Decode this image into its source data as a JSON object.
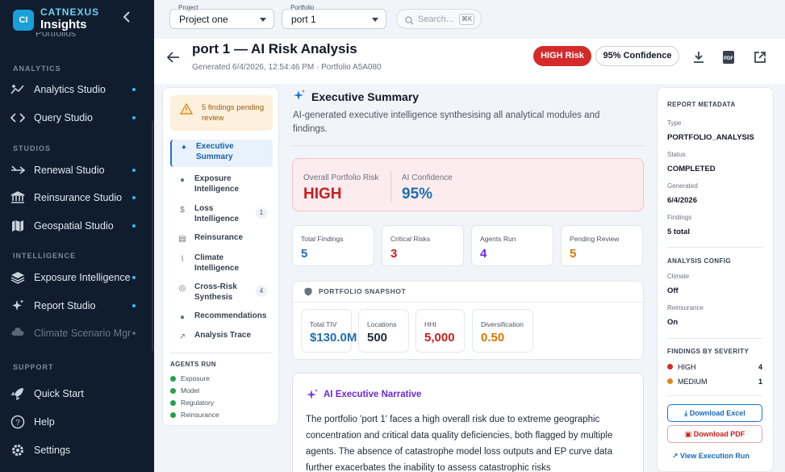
{
  "sidebar": {
    "brand_line1": "CATNEXUS",
    "brand_line2": "Insights",
    "logo_text": "CI",
    "ghost_item": "Portfolios",
    "sections": {
      "analytics": "ANALYTICS",
      "studios": "STUDIOS",
      "intelligence": "INTELLIGENCE",
      "support": "SUPPORT"
    },
    "items": [
      {
        "label": "Analytics Studio",
        "icon": "sparkle-chart-icon"
      },
      {
        "label": "Query Studio",
        "icon": "code-icon"
      },
      {
        "label": "Renewal Studio",
        "icon": "merge-arrow-icon"
      },
      {
        "label": "Reinsurance Studio",
        "icon": "bank-icon"
      },
      {
        "label": "Geospatial Studio",
        "icon": "map-icon"
      },
      {
        "label": "Exposure Intelligence",
        "icon": "layers-icon"
      },
      {
        "label": "Report Studio",
        "icon": "sparkles-icon"
      },
      {
        "label": "Climate Scenario Mgr",
        "icon": "cloud-icon"
      },
      {
        "label": "Quick Start",
        "icon": "rocket-icon"
      },
      {
        "label": "Help",
        "icon": "help-icon"
      },
      {
        "label": "Settings",
        "icon": "gear-icon"
      }
    ]
  },
  "topbar": {
    "project_caption": "Project",
    "project_value": "Project one",
    "portfolio_caption": "Portfolio",
    "portfolio_value": "port 1",
    "search_placeholder": "Search...",
    "search_shortcut": "⌘K"
  },
  "header": {
    "title": "port 1 — AI Risk Analysis",
    "subtitle": "Generated 6/4/2026, 12:54:46 PM · Portfolio A5A080",
    "risk_badge": "HIGH Risk",
    "confidence_badge": "95% Confidence"
  },
  "leftnav": {
    "pending": "5 findings pending review",
    "items": [
      {
        "label": "Executive Summary",
        "count": ""
      },
      {
        "label": "Exposure Intelligence",
        "count": ""
      },
      {
        "label": "Loss Intelligence",
        "count": "1"
      },
      {
        "label": "Reinsurance",
        "count": ""
      },
      {
        "label": "Climate Intelligence",
        "count": ""
      },
      {
        "label": "Cross-Risk Synthesis",
        "count": "4"
      },
      {
        "label": "Recommendations",
        "count": ""
      },
      {
        "label": "Analysis Trace",
        "count": ""
      }
    ],
    "agents_heading": "AGENTS RUN",
    "agents": [
      "Exposure",
      "Model",
      "Regulatory",
      "Reinsurance"
    ]
  },
  "summary": {
    "title": "Executive Summary",
    "description": "AI-generated executive intelligence synthesising all analytical modules and findings.",
    "overall_risk_label": "Overall Portfolio Risk",
    "overall_risk_value": "HIGH",
    "ai_conf_label": "AI Confidence",
    "ai_conf_value": "95%",
    "stats": [
      {
        "label": "Total Findings",
        "value": "5",
        "color": "#1f6fb3"
      },
      {
        "label": "Critical Risks",
        "value": "3",
        "color": "#c81e1e"
      },
      {
        "label": "Agents Run",
        "value": "4",
        "color": "#6d28d9"
      },
      {
        "label": "Pending Review",
        "value": "5",
        "color": "#d97706"
      }
    ],
    "snapshot_heading": "PORTFOLIO SNAPSHOT",
    "snapshot": [
      {
        "label": "Total TIV",
        "value": "$130.0M",
        "color": "#1f6fb3"
      },
      {
        "label": "Locations",
        "value": "500",
        "color": "#1f2937"
      },
      {
        "label": "HHI",
        "value": "5,000",
        "color": "#c81e1e"
      },
      {
        "label": "Diversification",
        "value": "0.50",
        "color": "#d97706"
      }
    ],
    "narrative_heading": "AI Executive Narrative",
    "narrative": "The portfolio 'port 1' faces a high overall risk due to extreme geographic concentration and critical data quality deficiencies, both flagged by multiple agents. The absence of catastrophe model loss outputs and EP curve data further exacerbates the inability to assess catastrophic risks"
  },
  "metadata": {
    "heading": "REPORT METADATA",
    "type_label": "Type",
    "type_value": "PORTFOLIO_ANALYSIS",
    "status_label": "Status",
    "status_value": "COMPLETED",
    "generated_label": "Generated",
    "generated_value": "6/4/2026",
    "findings_label": "Findings",
    "findings_value": "5 total",
    "config_heading": "ANALYSIS CONFIG",
    "climate_label": "Climate",
    "climate_value": "Off",
    "reinsurance_label": "Reinsurance",
    "reinsurance_value": "On",
    "severity_heading": "FINDINGS BY SEVERITY",
    "severity": [
      {
        "label": "HIGH",
        "count": "4",
        "color": "#d42a2a"
      },
      {
        "label": "MEDIUM",
        "count": "1",
        "color": "#e0861e"
      }
    ],
    "download_excel": "Download Excel",
    "download_pdf": "Download PDF",
    "view_execution": "View Execution Run"
  }
}
